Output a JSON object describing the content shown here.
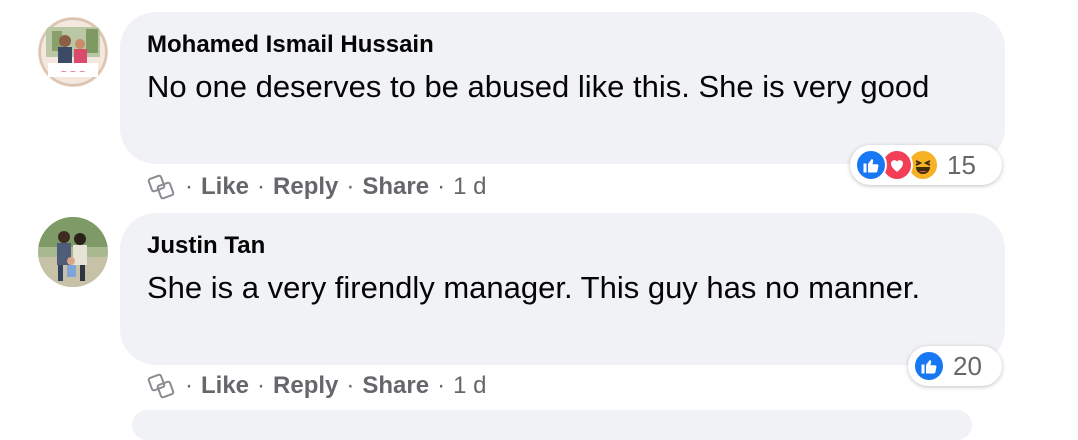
{
  "comments": [
    {
      "author": "Mohamed Ismail Hussain",
      "text": "No one deserves to be abused like this. She is very good",
      "reactions": {
        "types": [
          "like-icon",
          "love-icon",
          "haha-icon"
        ],
        "count": "15"
      },
      "actions": {
        "like": "Like",
        "reply": "Reply",
        "share": "Share",
        "time": "1 d"
      }
    },
    {
      "author": "Justin Tan",
      "text": "She is a very firendly manager. This guy has no manner.",
      "reactions": {
        "types": [
          "like-icon"
        ],
        "count": "20"
      },
      "actions": {
        "like": "Like",
        "reply": "Reply",
        "share": "Share",
        "time": "1 d"
      }
    }
  ],
  "colors": {
    "bubble": "#f0f2f5",
    "secondary_text": "#65676b",
    "like_blue": "#1877f2",
    "love_red": "#f33e58",
    "haha_yellow": "#f7b125"
  }
}
